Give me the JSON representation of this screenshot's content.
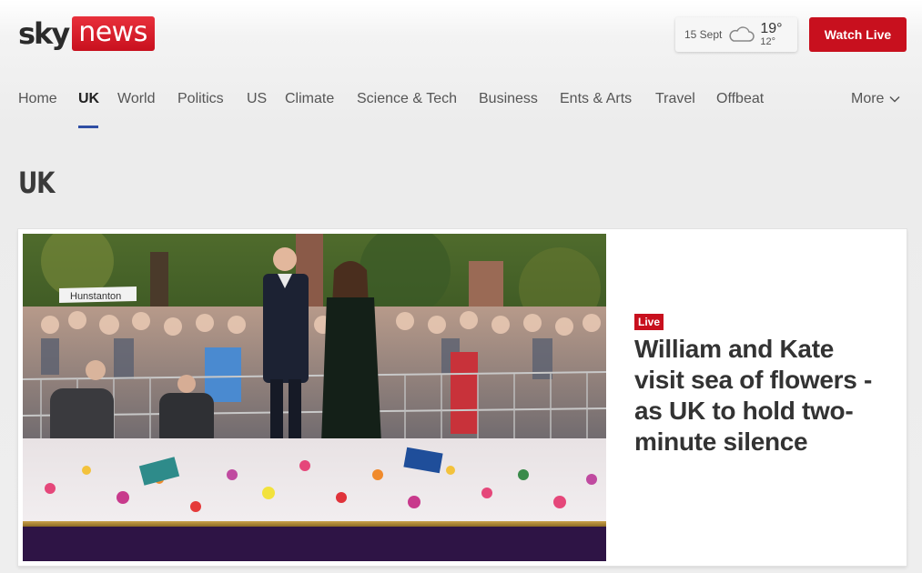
{
  "brand": {
    "sky": "sky",
    "news": "news",
    "accent": "#c8101e"
  },
  "weather": {
    "date": "15 Sept",
    "high": "19°",
    "low": "12°",
    "icon": "cloud-icon"
  },
  "watch_live": {
    "label": "Watch Live"
  },
  "nav": {
    "items": [
      {
        "label": "Home"
      },
      {
        "label": "UK",
        "active": true
      },
      {
        "label": "World"
      },
      {
        "label": "Politics"
      },
      {
        "label": "US"
      },
      {
        "label": "Climate"
      },
      {
        "label": "Science & Tech"
      },
      {
        "label": "Business"
      },
      {
        "label": "Ents & Arts"
      },
      {
        "label": "Travel"
      },
      {
        "label": "Offbeat"
      }
    ],
    "more": "More",
    "active_color": "#2f4ea4"
  },
  "section": {
    "title": "UK"
  },
  "lead_story": {
    "badge": "Live",
    "headline": "William and Kate visit sea of flowers - as UK to hold two-minute silence",
    "image_sign": "Hunstanton"
  }
}
